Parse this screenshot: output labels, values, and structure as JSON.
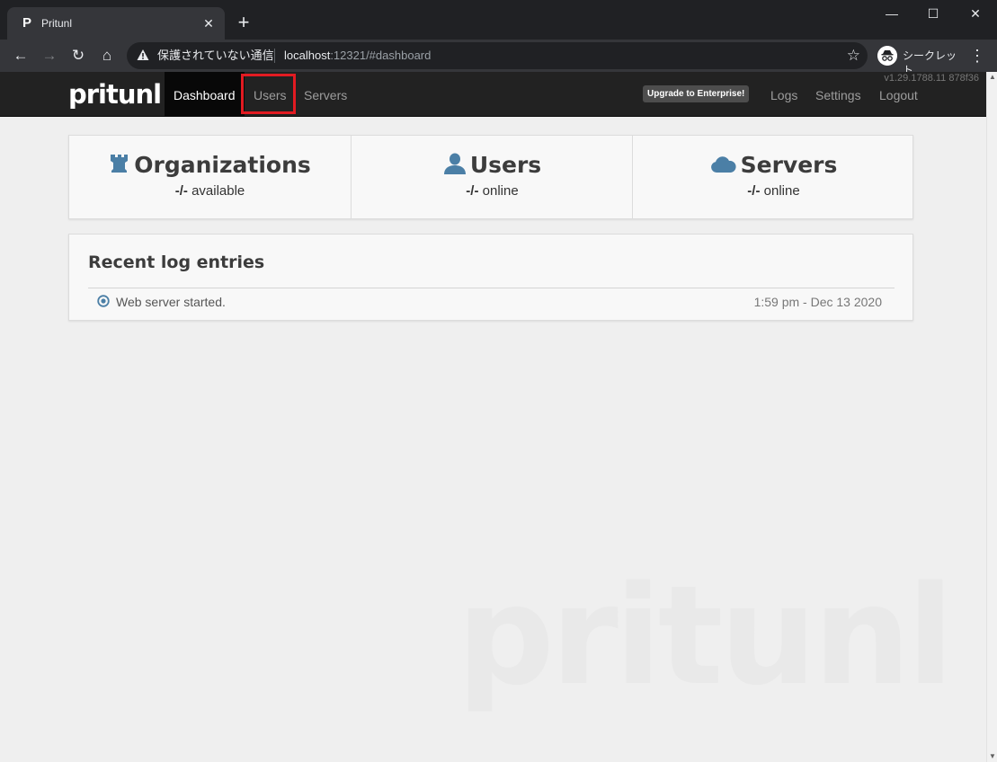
{
  "browser": {
    "tab_title": "Pritunl",
    "tab_favicon": "P",
    "tab_close": "✕",
    "new_tab": "+",
    "window": {
      "minimize": "—",
      "maximize": "☐",
      "close": "✕"
    },
    "nav": {
      "back": "←",
      "forward": "→",
      "reload": "↻",
      "home": "⌂"
    },
    "security_label": "保護されていない通信",
    "url_host": "localhost",
    "url_rest": ":12321/#dashboard",
    "bookmark_star": "☆",
    "incognito_label": "シークレット",
    "menu": "⋮"
  },
  "app": {
    "brand": "pritunl",
    "version": "v1.29.1788.11 878f36",
    "nav_left": [
      {
        "label": "Dashboard",
        "active": true
      },
      {
        "label": "Users",
        "active": false,
        "highlighted": true
      },
      {
        "label": "Servers",
        "active": false
      }
    ],
    "upgrade_button": "Upgrade to Enterprise!",
    "nav_right": [
      {
        "label": "Logs"
      },
      {
        "label": "Settings"
      },
      {
        "label": "Logout"
      }
    ],
    "highlight_color": "#e21b22"
  },
  "stats": [
    {
      "icon": "rook-icon",
      "title": "Organizations",
      "value": "-/-",
      "suffix": "available"
    },
    {
      "icon": "user-icon",
      "title": "Users",
      "value": "-/-",
      "suffix": "online"
    },
    {
      "icon": "cloud-icon",
      "title": "Servers",
      "value": "-/-",
      "suffix": "online"
    }
  ],
  "logs": {
    "title": "Recent log entries",
    "entries": [
      {
        "message": "Web server started.",
        "time": "1:59 pm - Dec 13 2020"
      }
    ]
  },
  "watermark": "pritunl",
  "colors": {
    "accent_icon": "#4b7fa6",
    "navbar": "#222222"
  }
}
